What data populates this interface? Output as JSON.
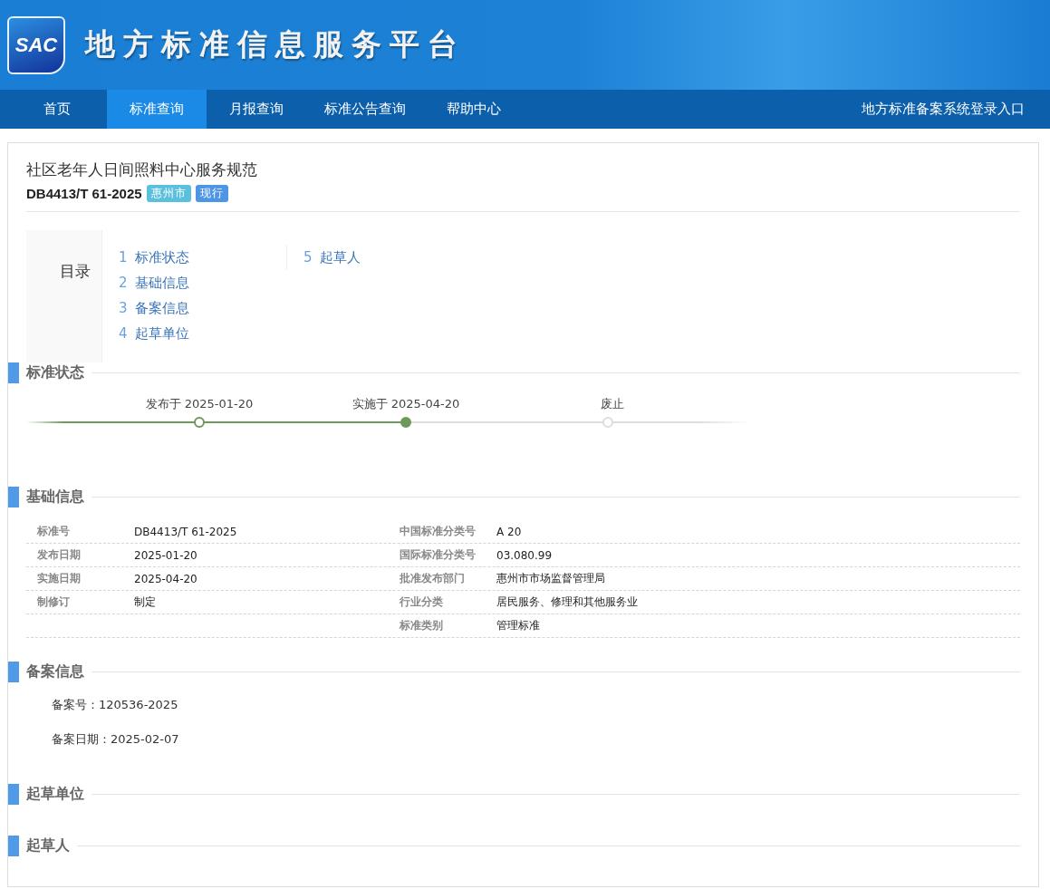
{
  "header": {
    "logo": "SAC",
    "title": "地方标准信息服务平台"
  },
  "nav": {
    "items": [
      {
        "label": "首页",
        "selected": false
      },
      {
        "label": "标准查询",
        "selected": true
      },
      {
        "label": "月报查询",
        "selected": false
      },
      {
        "label": "标准公告查询",
        "selected": false
      },
      {
        "label": "帮助中心",
        "selected": false
      }
    ],
    "login_link": "地方标准备案系统登录入口"
  },
  "standard": {
    "title": "社区老年人日间照料中心服务规范",
    "code": "DB4413/T 61-2025",
    "tags": [
      {
        "label": "惠州市",
        "color": "#5bc0de"
      },
      {
        "label": "现行",
        "color": "#4f95e6"
      }
    ]
  },
  "toc": {
    "title": "目录",
    "items": [
      {
        "number": "1",
        "label": "标准状态"
      },
      {
        "number": "2",
        "label": "基础信息"
      },
      {
        "number": "3",
        "label": "备案信息"
      },
      {
        "number": "4",
        "label": "起草单位"
      },
      {
        "number": "5",
        "label": "起草人"
      }
    ]
  },
  "sections": [
    {
      "kind": "timeline",
      "title": "标准状态",
      "level": 0.52,
      "steps": [
        {
          "label": "发布于 2025-01-20",
          "reached": true,
          "current": false
        },
        {
          "label": "实施于 2025-04-20",
          "reached": true,
          "current": true
        },
        {
          "label": "废止",
          "reached": false,
          "current": false
        }
      ]
    },
    {
      "kind": "table",
      "title": "基础信息",
      "rows": [
        {
          "left": {
            "label": "标准号",
            "value": "DB4413/T 61-2025"
          },
          "right": {
            "label": "中国标准分类号",
            "value": "A 20"
          }
        },
        {
          "left": {
            "label": "发布日期",
            "value": "2025-01-20"
          },
          "right": {
            "label": "国际标准分类号",
            "value": "03.080.99"
          }
        },
        {
          "left": {
            "label": "实施日期",
            "value": "2025-04-20"
          },
          "right": {
            "label": "批准发布部门",
            "value": "惠州市市场监督管理局"
          }
        },
        {
          "left": {
            "label": "制修订",
            "value": "制定"
          },
          "right": {
            "label": "行业分类",
            "value": "居民服务、修理和其他服务业"
          }
        },
        {
          "right": {
            "label": "标准类别",
            "value": "管理标准"
          }
        }
      ]
    },
    {
      "kind": "list",
      "title": "备案信息",
      "lines": [
        "备案号：120536-2025",
        "备案日期：2025-02-07"
      ]
    },
    {
      "kind": "empty",
      "title": "起草单位"
    },
    {
      "kind": "empty",
      "title": "起草人"
    }
  ]
}
